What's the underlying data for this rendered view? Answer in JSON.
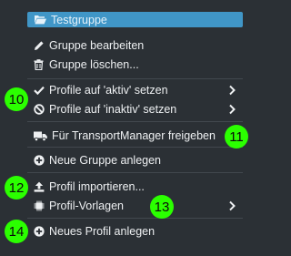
{
  "menu": {
    "group_title": "Testgruppe",
    "items": [
      {
        "label": "Gruppe bearbeiten",
        "icon": "pencil-icon"
      },
      {
        "label": "Gruppe löschen...",
        "icon": "trash-icon"
      },
      {
        "label": "Profile auf 'aktiv' setzen",
        "icon": "check-icon"
      },
      {
        "label": "Profile auf 'inaktiv' setzen",
        "icon": "ban-icon"
      },
      {
        "label": "Für TransportManager freigeben",
        "icon": "truck-icon"
      },
      {
        "label": "Neue Gruppe anlegen",
        "icon": "plus-circle-icon"
      },
      {
        "label": "Profil importieren...",
        "icon": "upload-icon"
      },
      {
        "label": "Profil-Vorlagen",
        "icon": "chip-icon"
      },
      {
        "label": "Neues Profil anlegen",
        "icon": "plus-circle-icon"
      }
    ]
  },
  "badges": [
    "10",
    "11",
    "12",
    "13",
    "14"
  ],
  "colors": {
    "background": "#2b3035",
    "highlight": "#4096c7",
    "text": "#eef0f2",
    "badge": "#2bff00"
  }
}
